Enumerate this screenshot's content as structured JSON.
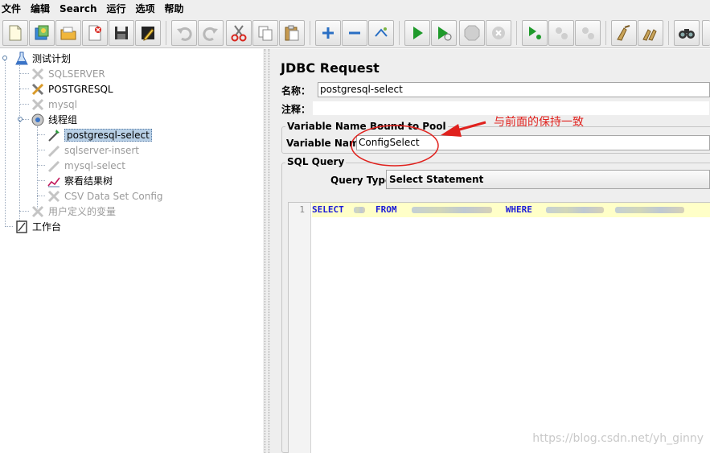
{
  "menu": [
    "文件",
    "编辑",
    "Search",
    "运行",
    "选项",
    "帮助"
  ],
  "toolbar": {
    "buttons": [
      "new-icon",
      "templates-icon",
      "open-icon",
      "close-icon",
      "save-icon",
      "edit-icon",
      "undo-icon",
      "redo-icon",
      "cut-icon",
      "copy-icon",
      "paste-icon",
      "expand-icon",
      "collapse-icon",
      "toggle-icon",
      "start-icon",
      "start-no-pause-icon",
      "stop-icon",
      "shutdown-icon",
      "remote-start-icon",
      "remote-stop-icon",
      "remote-shutdown-icon",
      "clear-icon",
      "clear-all-icon",
      "search-icon"
    ]
  },
  "tree": {
    "nodes": [
      {
        "label": "测试计划",
        "icon": "test-plan-icon",
        "disabled": false
      },
      {
        "label": "SQLSERVER",
        "icon": "jdbc-config-icon",
        "disabled": true
      },
      {
        "label": "POSTGRESQL",
        "icon": "jdbc-config-icon",
        "disabled": false
      },
      {
        "label": "mysql",
        "icon": "jdbc-config-icon",
        "disabled": true
      },
      {
        "label": "线程组",
        "icon": "thread-group-icon",
        "disabled": false
      },
      {
        "label": "postgresql-select",
        "icon": "sampler-icon",
        "disabled": false,
        "selected": true
      },
      {
        "label": "sqlserver-insert",
        "icon": "sampler-icon",
        "disabled": true
      },
      {
        "label": "mysql-select",
        "icon": "sampler-icon",
        "disabled": true
      },
      {
        "label": "察看结果树",
        "icon": "listener-icon",
        "disabled": false
      },
      {
        "label": "CSV Data Set Config",
        "icon": "config-icon",
        "disabled": true
      },
      {
        "label": "用户定义的变量",
        "icon": "config-icon",
        "disabled": true
      },
      {
        "label": "工作台",
        "icon": "workbench-icon",
        "disabled": false
      }
    ]
  },
  "panel": {
    "title": "JDBC Request",
    "name_label": "名称：",
    "name_value": "postgresql-select",
    "comment_label": "注释：",
    "pool_group_title": "Variable Name Bound to Pool",
    "variable_name_label": "Variable Name:",
    "variable_name_value": "ConfigSelect",
    "sql_group_title": "SQL Query",
    "query_type_label": "Query Type:",
    "query_type_value": "Select Statement",
    "sql": {
      "line_number": "1",
      "kw_select": "SELECT",
      "kw_from": "FROM",
      "kw_where": "WHERE"
    }
  },
  "annotation": {
    "text": "与前面的保持一致",
    "color": "#e0211d"
  },
  "watermark": "https://blog.csdn.net/yh_ginny"
}
